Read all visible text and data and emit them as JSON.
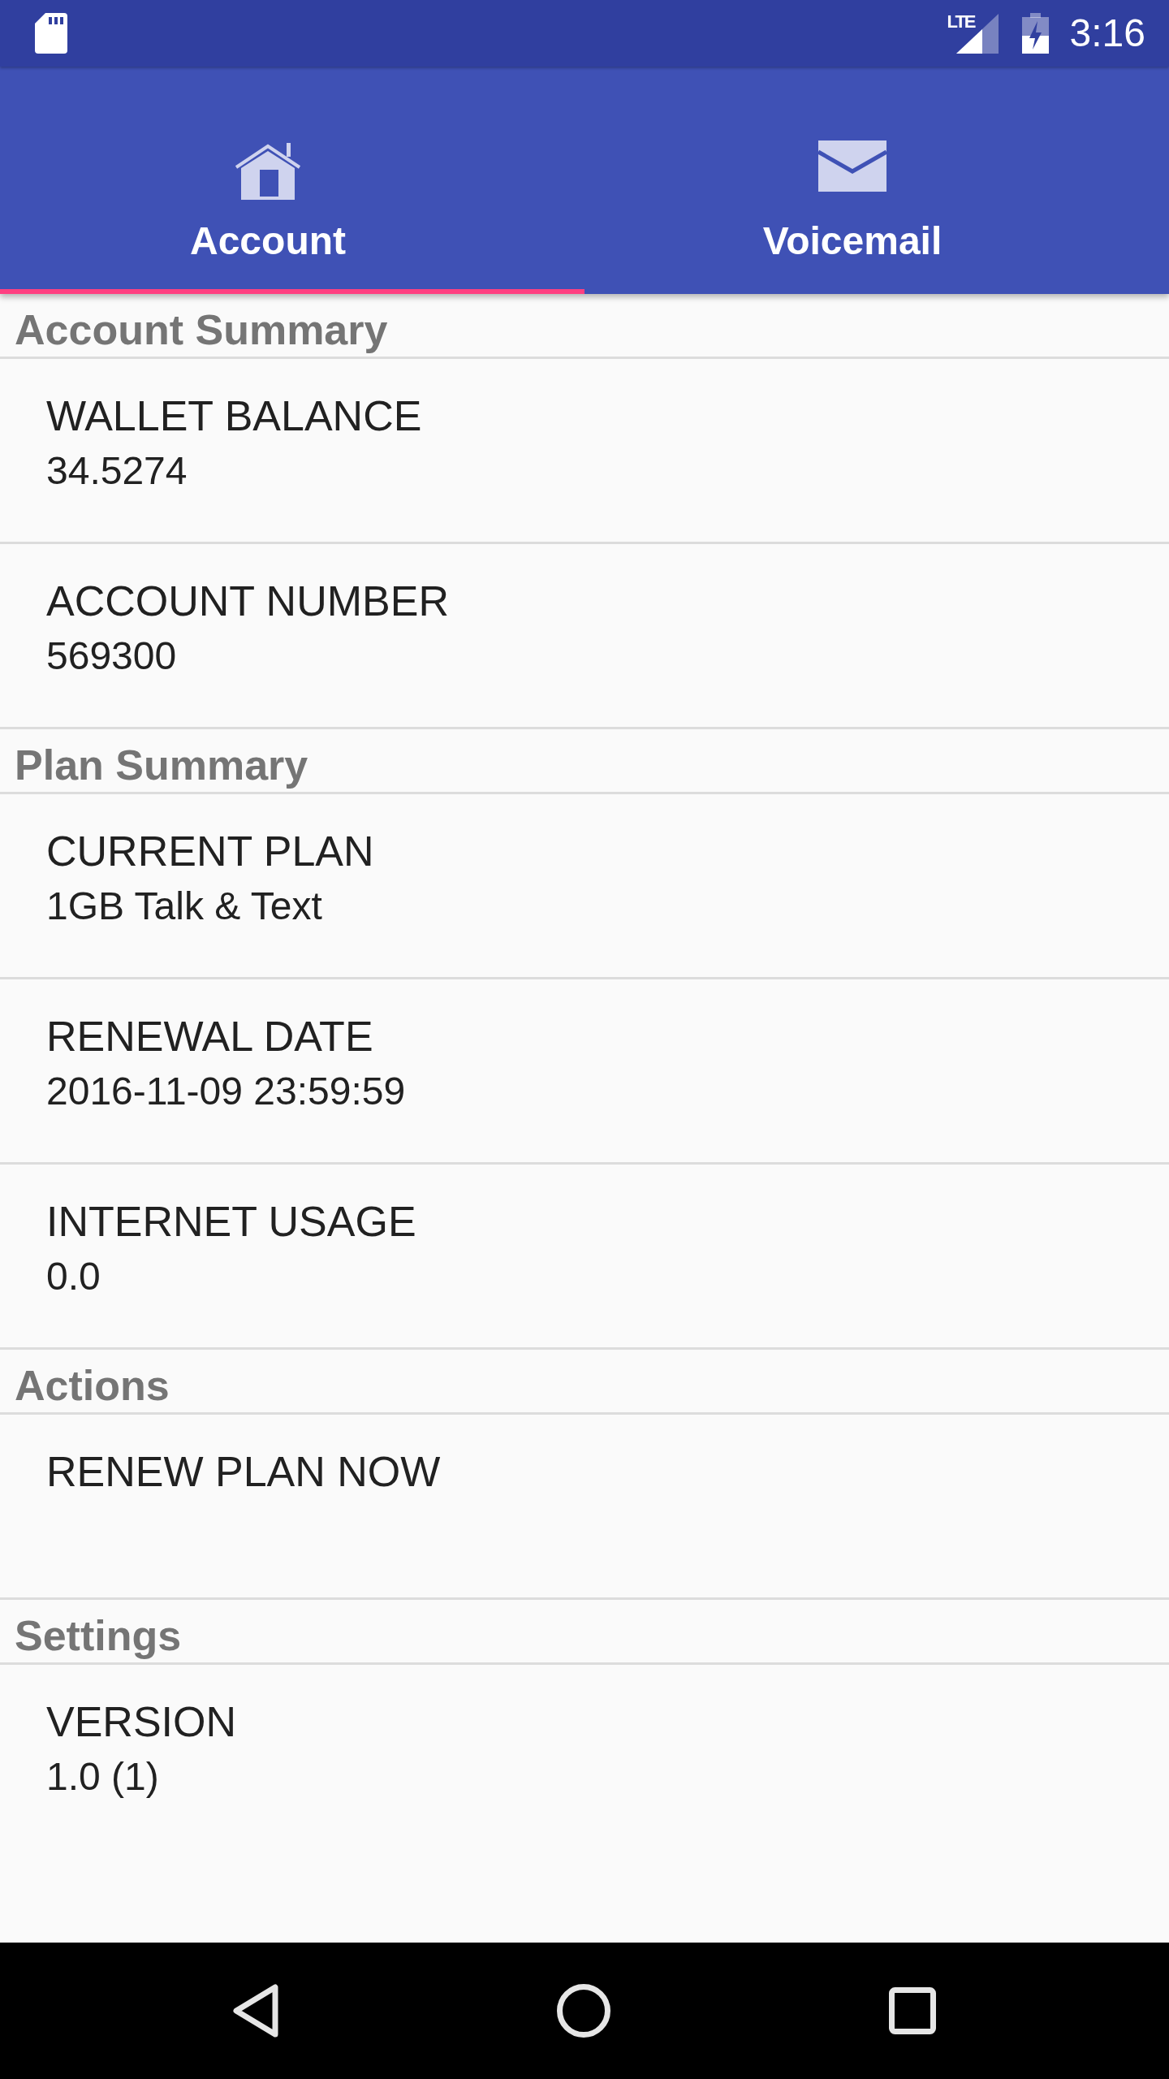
{
  "status_bar": {
    "network_type": "LTE",
    "time": "3:16"
  },
  "tabs": [
    {
      "label": "Account",
      "selected": true
    },
    {
      "label": "Voicemail",
      "selected": false
    }
  ],
  "sections": [
    {
      "title": "Account Summary",
      "items": [
        {
          "kind": "info",
          "label": "WALLET BALANCE",
          "value": "34.5274"
        },
        {
          "kind": "info",
          "label": "ACCOUNT NUMBER",
          "value": "569300"
        }
      ]
    },
    {
      "title": "Plan Summary",
      "items": [
        {
          "kind": "info",
          "label": "CURRENT PLAN",
          "value": "1GB Talk & Text"
        },
        {
          "kind": "info",
          "label": "RENEWAL DATE",
          "value": "2016-11-09 23:59:59"
        },
        {
          "kind": "info",
          "label": "INTERNET USAGE",
          "value": "0.0"
        }
      ]
    },
    {
      "title": "Actions",
      "items": [
        {
          "kind": "action",
          "label": "RENEW PLAN NOW"
        }
      ]
    },
    {
      "title": "Settings",
      "items": [
        {
          "kind": "info",
          "label": "VERSION",
          "value": "1.0 (1)"
        }
      ]
    }
  ]
}
